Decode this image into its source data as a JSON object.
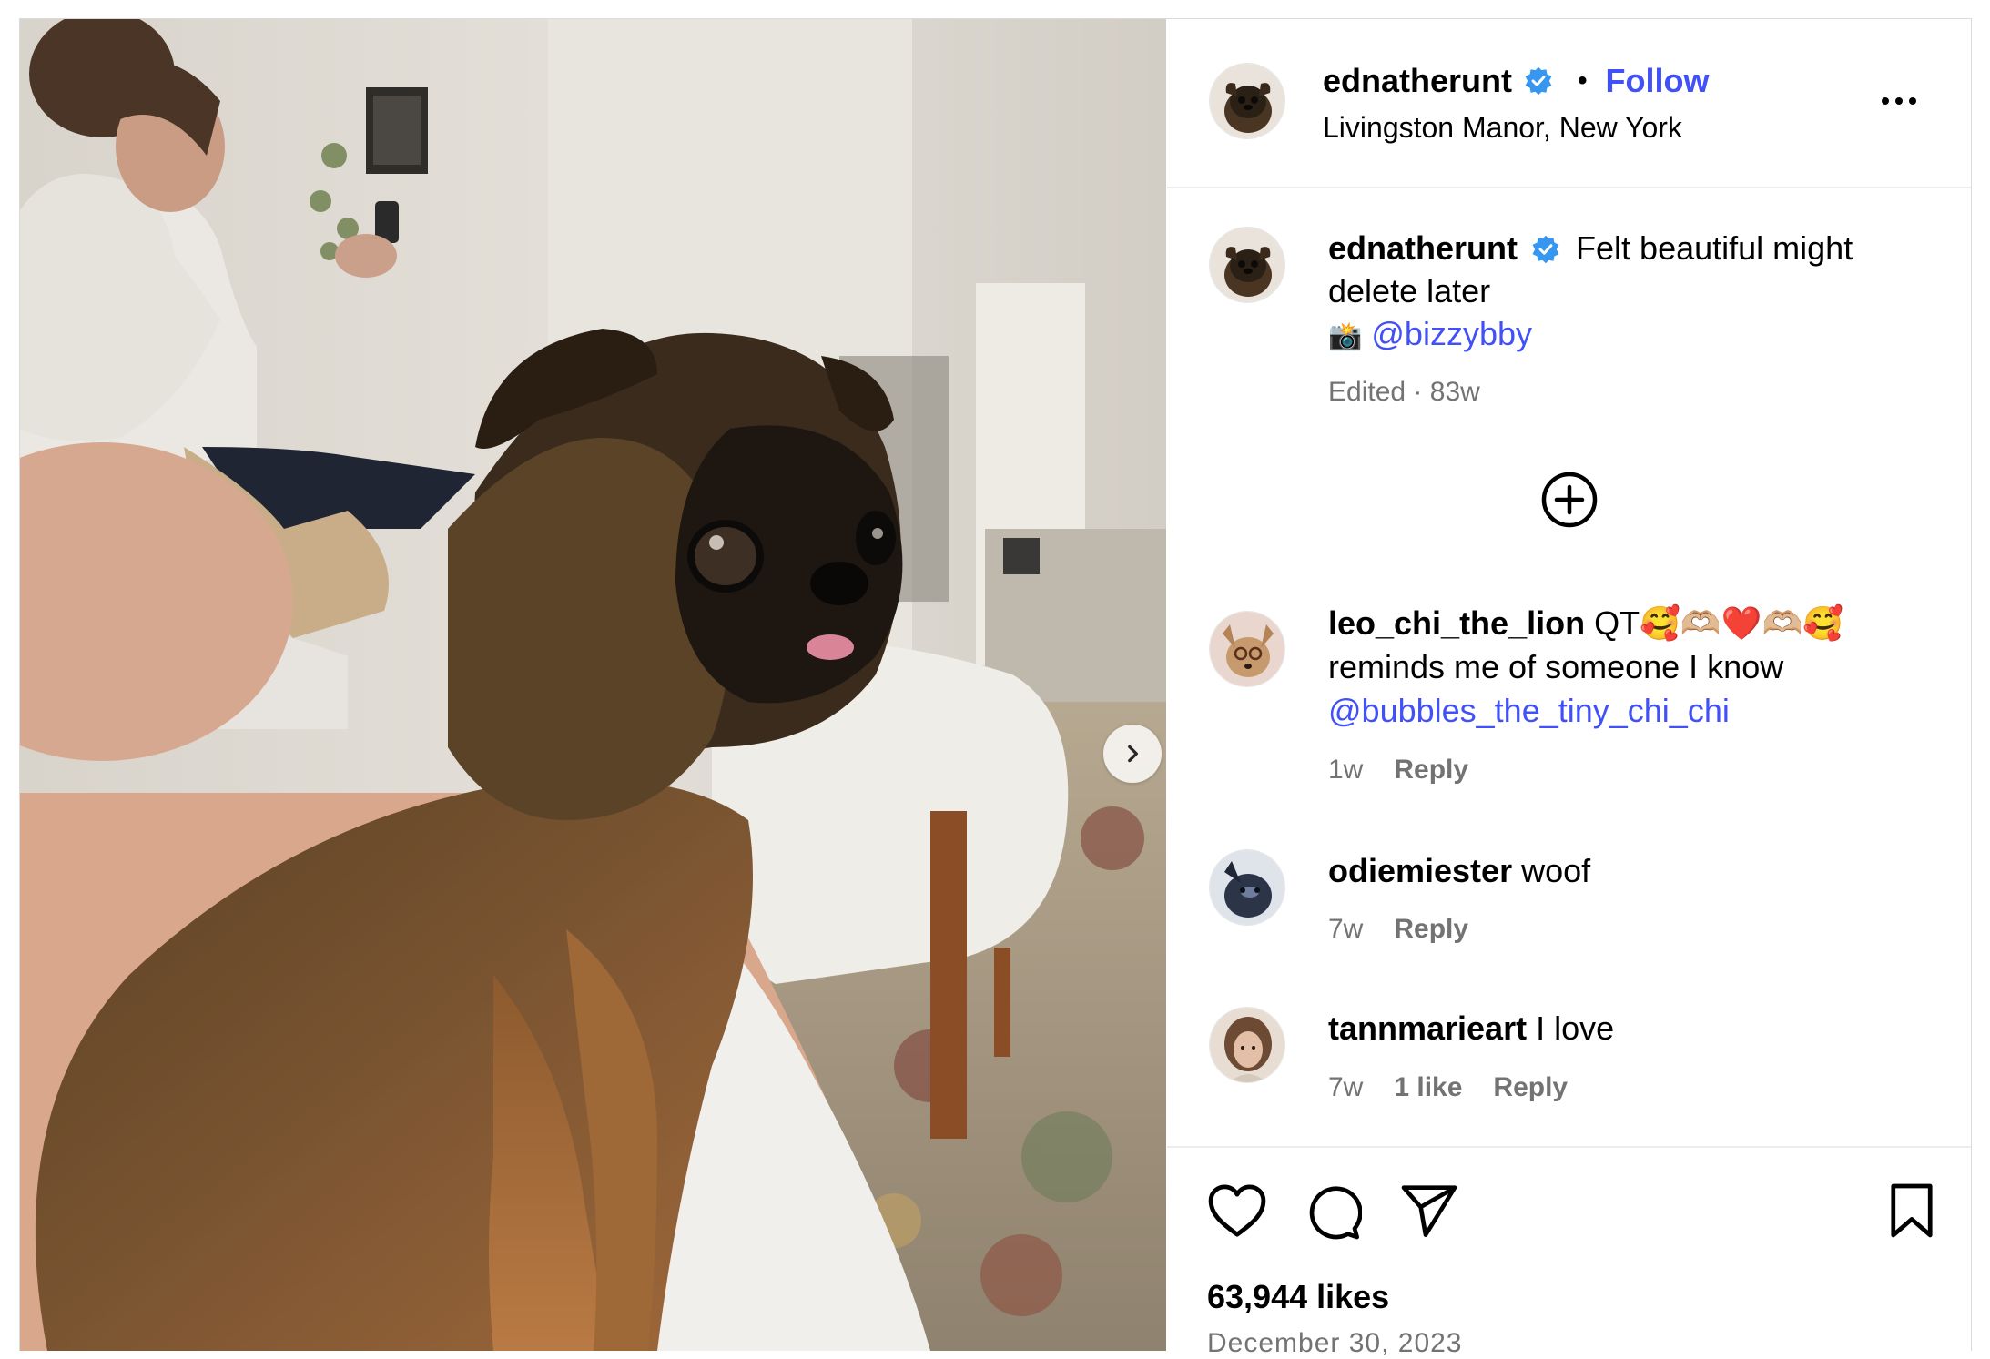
{
  "post": {
    "username": "ednatherunt",
    "location": "Livingston Manor, New York",
    "follow_label": "Follow",
    "separator": "•",
    "caption_text": "Felt beautiful might delete later",
    "caption_camera": "📸",
    "caption_mention": "@bizzybby",
    "edited_label": "Edited",
    "meta_separator": "·",
    "age": "83w",
    "likes": "63,944 likes",
    "date": "December 30, 2023"
  },
  "comments": [
    {
      "username": "leo_chi_the_lion",
      "text": "QT🥰🫶🏼❤️🫶🏼🥰 reminds me of someone I know",
      "mention": "@bubbles_the_tiny_chi_chi",
      "age": "1w",
      "likes": "",
      "reply_label": "Reply"
    },
    {
      "username": "odiemiester",
      "text": "woof",
      "mention": "",
      "age": "7w",
      "likes": "",
      "reply_label": "Reply"
    },
    {
      "username": "tannmarieart",
      "text": "I love",
      "mention": "",
      "age": "7w",
      "likes": "1 like",
      "reply_label": "Reply"
    }
  ],
  "icons": {
    "verified": "verified-badge-icon",
    "more": "more-options-icon",
    "add_comment": "add-circle-icon",
    "like": "heart-icon",
    "comment": "comment-bubble-icon",
    "share": "send-paper-plane-icon",
    "save": "bookmark-icon",
    "next": "chevron-right-icon"
  },
  "colors": {
    "link": "#4150f7",
    "verified": "#3797f0",
    "meta": "#737373",
    "divider": "#ececec"
  }
}
